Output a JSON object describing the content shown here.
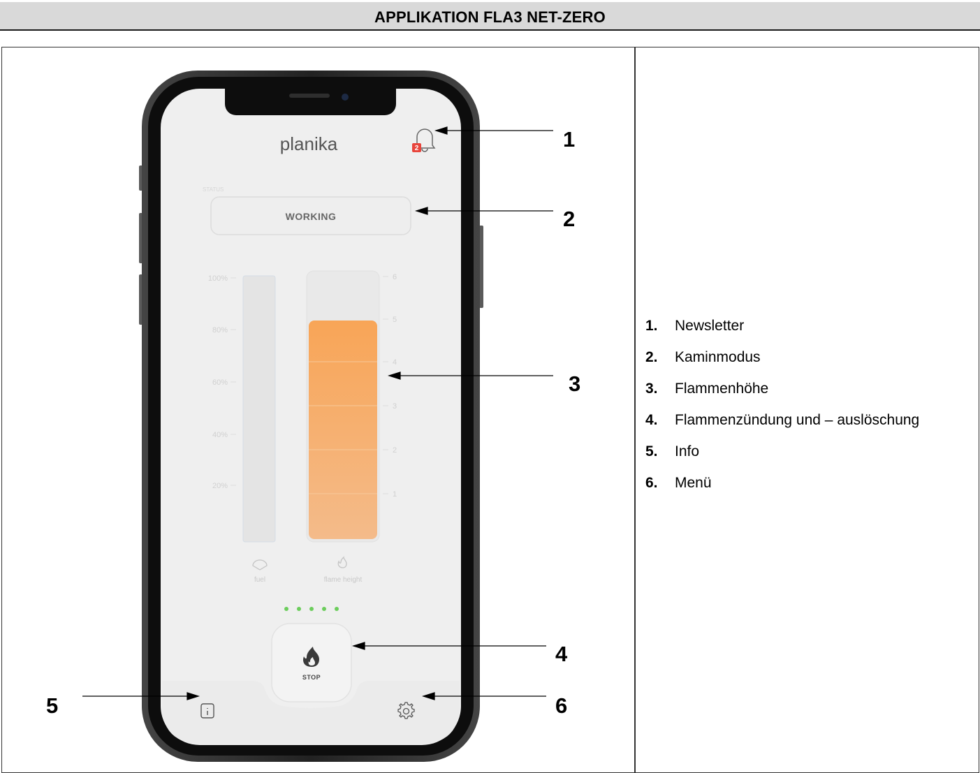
{
  "header": {
    "title": "APPLIKATION FLA3 NET-ZERO"
  },
  "app": {
    "logo": "planika",
    "notification_count": "2",
    "status_label": "STATUS",
    "status_value": "WORKING",
    "fuel_ticks": [
      "100%",
      "80%",
      "60%",
      "40%",
      "20%"
    ],
    "flame_ticks": [
      "6",
      "5",
      "4",
      "3",
      "2",
      "1"
    ],
    "fuel_label": "fuel",
    "flame_label": "flame height",
    "flame_level": 5,
    "flame_level_max": 6,
    "stop_label": "STOP",
    "indicator_dots": 5,
    "colors": {
      "flame": "#f6a860",
      "indicator": "#6ccd5c",
      "badge": "#e8453c"
    }
  },
  "callouts": [
    "1",
    "2",
    "3",
    "4",
    "5",
    "6"
  ],
  "legend": [
    {
      "num": "1.",
      "text": "Newsletter"
    },
    {
      "num": "2.",
      "text": "Kaminmodus"
    },
    {
      "num": "3.",
      "text": "Flammenhöhe"
    },
    {
      "num": "4.",
      "text": "Flammenzündung und – auslöschung"
    },
    {
      "num": "5.",
      "text": "Info"
    },
    {
      "num": "6.",
      "text": "Menü"
    }
  ]
}
